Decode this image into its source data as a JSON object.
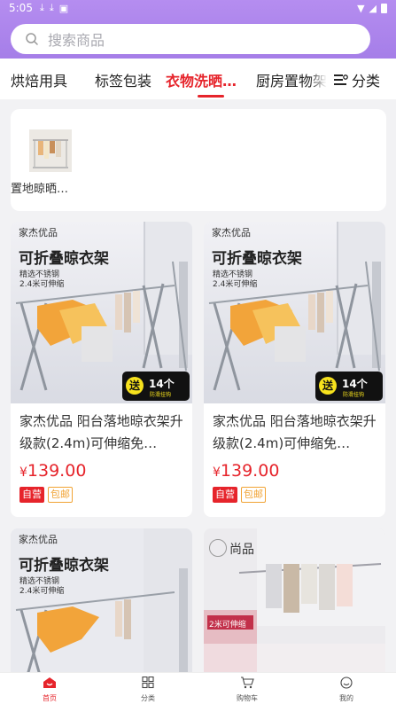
{
  "status": {
    "time": "5:05"
  },
  "search": {
    "placeholder": "搜索商品"
  },
  "tabs": [
    {
      "label": "烘焙用具",
      "active": false
    },
    {
      "label": "标签包装",
      "active": false
    },
    {
      "label": "衣物洗晒…",
      "active": true
    },
    {
      "label": "厨房置物架",
      "active": false
    }
  ],
  "category_button": {
    "label": "分类"
  },
  "subcategories": [
    {
      "label": "置地晾晒…"
    }
  ],
  "products": [
    {
      "banner_brand": "家杰优品",
      "banner_title": "可折叠晾衣架",
      "banner_sub1": "精选不锈钢",
      "banner_sub2": "2.4米可伸缩",
      "banner_badge_gift": "送",
      "banner_badge_count": "14个",
      "banner_badge_text": "防滑挂钩",
      "title": "家杰优品 阳台落地晾衣架升级款(2.4m)可伸缩免…",
      "price_symbol": "¥",
      "price": "139.00",
      "tag_self": "自营",
      "tag_ship": "包邮"
    },
    {
      "banner_brand": "家杰优品",
      "banner_title": "可折叠晾衣架",
      "banner_sub1": "精选不锈钢",
      "banner_sub2": "2.4米可伸缩",
      "banner_badge_gift": "送",
      "banner_badge_count": "14个",
      "banner_badge_text": "防滑挂钩",
      "title": "家杰优品 阳台落地晾衣架升级款(2.4m)可伸缩免…",
      "price_symbol": "¥",
      "price": "139.00",
      "tag_self": "自营",
      "tag_ship": "包邮"
    },
    {
      "banner_brand": "家杰优品",
      "banner_title": "可折叠晾衣架",
      "banner_sub1": "精选不锈钢",
      "banner_sub2": "2.4米可伸缩"
    },
    {
      "banner_brand": "尚品",
      "banner_sub1": "2米可伸缩"
    }
  ],
  "bottom_nav": [
    {
      "label": "首页",
      "icon": "home-icon",
      "active": true
    },
    {
      "label": "分类",
      "icon": "grid-icon",
      "active": false
    },
    {
      "label": "购物车",
      "icon": "cart-icon",
      "active": false
    },
    {
      "label": "我的",
      "icon": "user-icon",
      "active": false
    }
  ],
  "colors": {
    "header": "#a57ee8",
    "accent": "#e6242b",
    "ship": "#f1a334"
  }
}
